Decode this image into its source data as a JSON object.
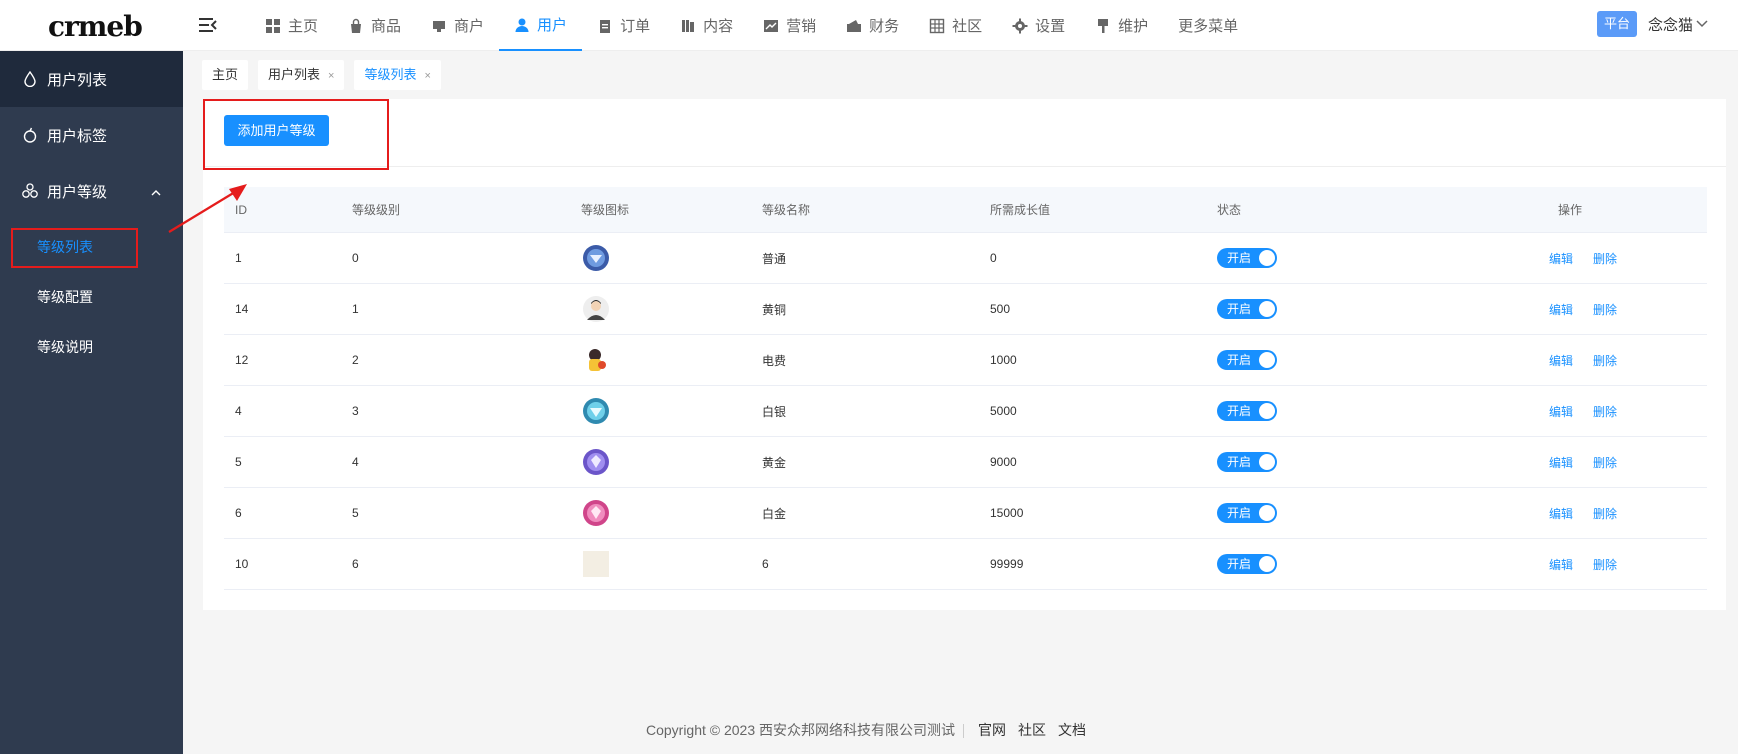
{
  "logo": "crmeb",
  "nav": [
    {
      "label": "主页",
      "icon": "grid-icon"
    },
    {
      "label": "商品",
      "icon": "bag-icon"
    },
    {
      "label": "商户",
      "icon": "shop-icon"
    },
    {
      "label": "用户",
      "icon": "user-icon"
    },
    {
      "label": "订单",
      "icon": "clipboard-icon"
    },
    {
      "label": "内容",
      "icon": "book-icon"
    },
    {
      "label": "营销",
      "icon": "chart-icon"
    },
    {
      "label": "财务",
      "icon": "wallet-icon"
    },
    {
      "label": "社区",
      "icon": "table-grid-icon"
    },
    {
      "label": "设置",
      "icon": "gear-icon"
    },
    {
      "label": "维护",
      "icon": "brush-icon"
    },
    {
      "label": "更多菜单",
      "icon": ""
    }
  ],
  "header": {
    "platform": "平台",
    "user": "念念猫"
  },
  "sidebar": {
    "items": [
      {
        "label": "用户列表"
      },
      {
        "label": "用户标签"
      },
      {
        "label": "用户等级"
      }
    ],
    "sub_items": [
      {
        "label": "等级列表"
      },
      {
        "label": "等级配置"
      },
      {
        "label": "等级说明"
      }
    ]
  },
  "tabs": [
    {
      "label": "主页",
      "closable": false
    },
    {
      "label": "用户列表",
      "closable": true
    },
    {
      "label": "等级列表",
      "closable": true
    }
  ],
  "tab_close": "×",
  "add_button": "添加用户等级",
  "table": {
    "headers": [
      "ID",
      "等级级别",
      "等级图标",
      "等级名称",
      "所需成长值",
      "状态",
      "操作"
    ],
    "rows": [
      {
        "id": "1",
        "level": "0",
        "icon": "blue-gem-icon",
        "name": "普通",
        "growth": "0",
        "status": "开启"
      },
      {
        "id": "14",
        "level": "1",
        "icon": "person-avatar-icon",
        "name": "黄铜",
        "growth": "500",
        "status": "开启"
      },
      {
        "id": "12",
        "level": "2",
        "icon": "character-avatar-icon",
        "name": "电费",
        "growth": "1000",
        "status": "开启"
      },
      {
        "id": "4",
        "level": "3",
        "icon": "cyan-diamond-icon",
        "name": "白银",
        "growth": "5000",
        "status": "开启"
      },
      {
        "id": "5",
        "level": "4",
        "icon": "purple-diamond-icon",
        "name": "黄金",
        "growth": "9000",
        "status": "开启"
      },
      {
        "id": "6",
        "level": "5",
        "icon": "pink-diamond-icon",
        "name": "白金",
        "growth": "15000",
        "status": "开启"
      },
      {
        "id": "10",
        "level": "6",
        "icon": "blank-image-icon",
        "name": "6",
        "growth": "99999",
        "status": "开启"
      }
    ],
    "edit": "编辑",
    "delete": "删除"
  },
  "footer": {
    "copyright": "Copyright © 2023 西安众邦网络科技有限公司测试",
    "links": [
      "官网",
      "社区",
      "文档"
    ]
  },
  "colors": {
    "accent": "#1890ff",
    "sidebar": "#2f3b4f",
    "highlight": "#e51c1c"
  }
}
